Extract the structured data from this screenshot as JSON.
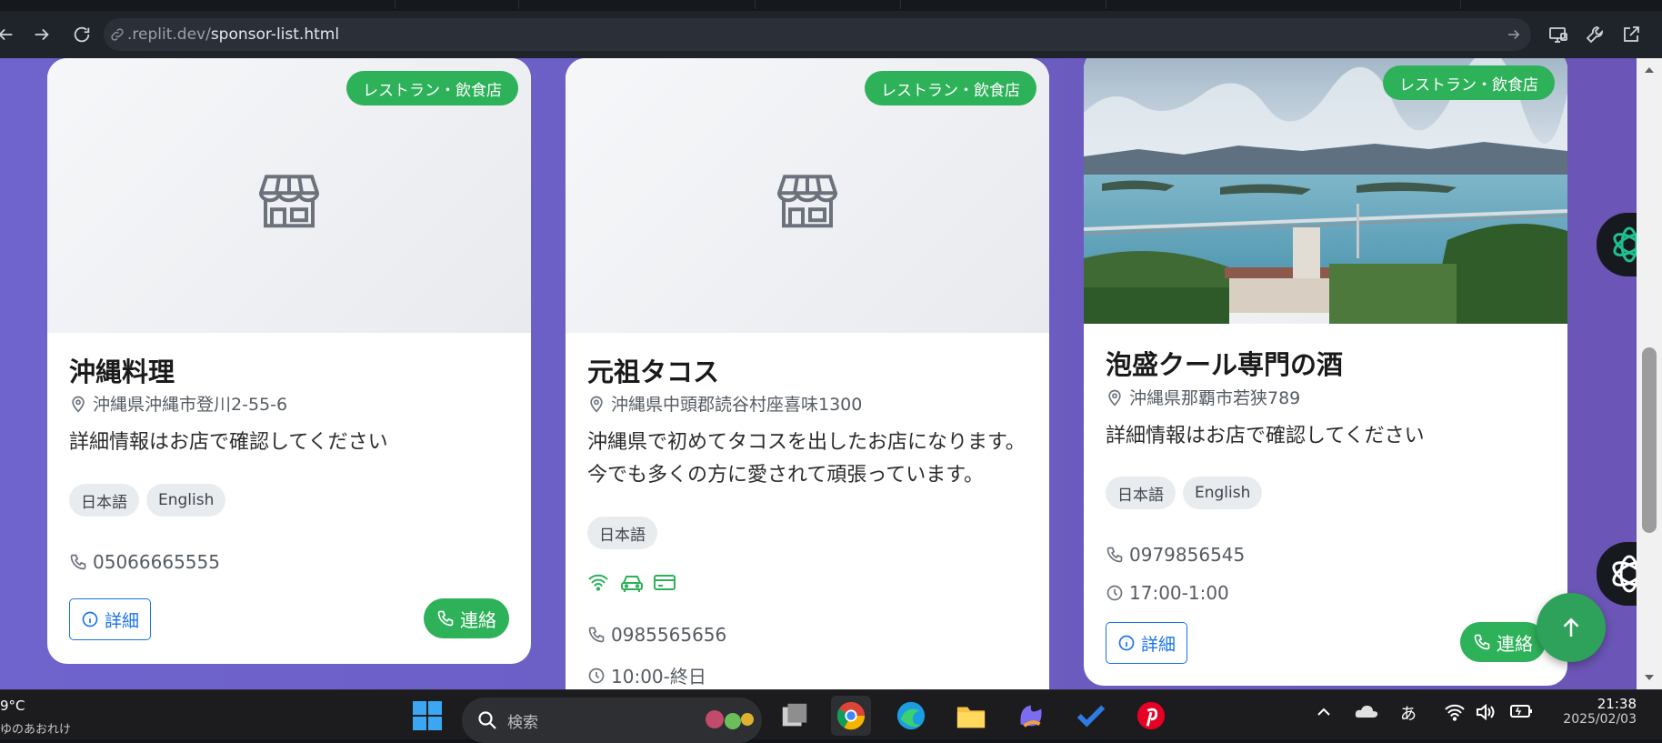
{
  "browser": {
    "url_prefix": ".replit.dev/",
    "url_path": "sponsor-list.html"
  },
  "cards": [
    {
      "category": "レストラン・飲食店",
      "title": "沖縄料理",
      "address": "沖縄県沖縄市登川2-55-6",
      "description": "詳細情報はお店で確認してください",
      "languages": [
        "日本語",
        "English"
      ],
      "phone": "05066665555",
      "detail_label": "詳細",
      "call_label": "連絡"
    },
    {
      "category": "レストラン・飲食店",
      "title": "元祖タコス",
      "address": "沖縄県中頭郡読谷村座喜味1300",
      "description": "沖縄県で初めてタコスを出したお店になります。今でも多くの方に愛されて頑張っています。",
      "languages": [
        "日本語"
      ],
      "amenities": [
        "wifi-icon",
        "car-icon",
        "credit-card-icon"
      ],
      "phone": "0985565656",
      "hours": "10:00-終日"
    },
    {
      "category": "レストラン・飲食店",
      "title": "泡盛クール専門の酒",
      "address": "沖縄県那覇市若狭789",
      "description": "詳細情報はお店で確認してください",
      "languages": [
        "日本語",
        "English"
      ],
      "phone": "0979856545",
      "hours": "17:00-1:00",
      "detail_label": "詳細",
      "call_label": "連絡"
    }
  ],
  "taskbar": {
    "weather_temp": "9°C",
    "weather_sub": "ゆのあおれけ",
    "search_placeholder": "検索",
    "ime": "あ",
    "time": "21:38",
    "date": "2025/02/03"
  },
  "colors": {
    "accent_green": "#2db159",
    "link_blue": "#1a73e8",
    "page_bg": "#6c5fc6"
  }
}
